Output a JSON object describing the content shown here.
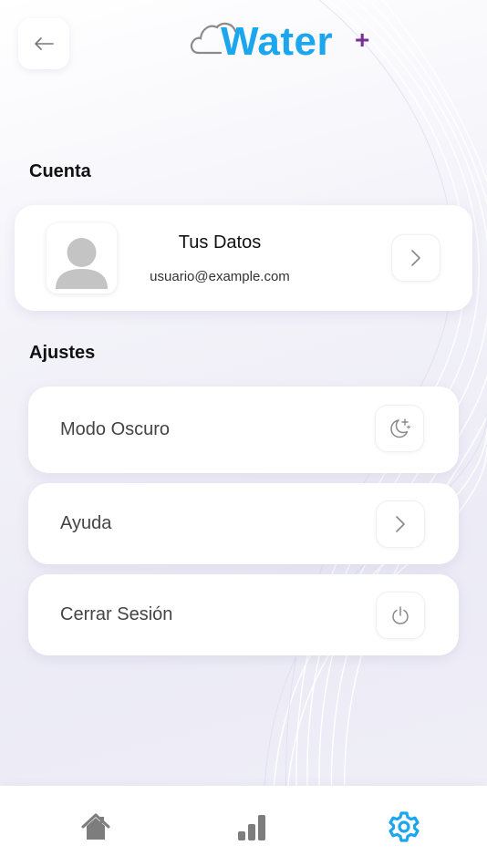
{
  "header": {
    "back_icon": "arrow-left-icon",
    "logo": {
      "text": "Water",
      "plus": "+",
      "primary_color": "#1ba6ee",
      "accent_color": "#7a2d97"
    }
  },
  "account": {
    "section_title": "Cuenta",
    "profile": {
      "name": "Tus Datos",
      "email": "usuario@example.com",
      "avatar_icon": "user-avatar-icon",
      "chevron_icon": "chevron-right-icon"
    }
  },
  "settings": {
    "section_title": "Ajustes",
    "items": [
      {
        "label": "Modo Oscuro",
        "icon": "moon-stars-icon"
      },
      {
        "label": "Ayuda",
        "icon": "chevron-right-icon"
      },
      {
        "label": "Cerrar Sesión",
        "icon": "power-icon"
      }
    ]
  },
  "tabbar": {
    "items": [
      {
        "name": "home",
        "icon": "home-icon",
        "active": false
      },
      {
        "name": "stats",
        "icon": "bar-chart-icon",
        "active": false
      },
      {
        "name": "settings",
        "icon": "gear-icon",
        "active": true
      }
    ],
    "active_color": "#1ba6ee",
    "inactive_color": "#7d7d7d"
  }
}
